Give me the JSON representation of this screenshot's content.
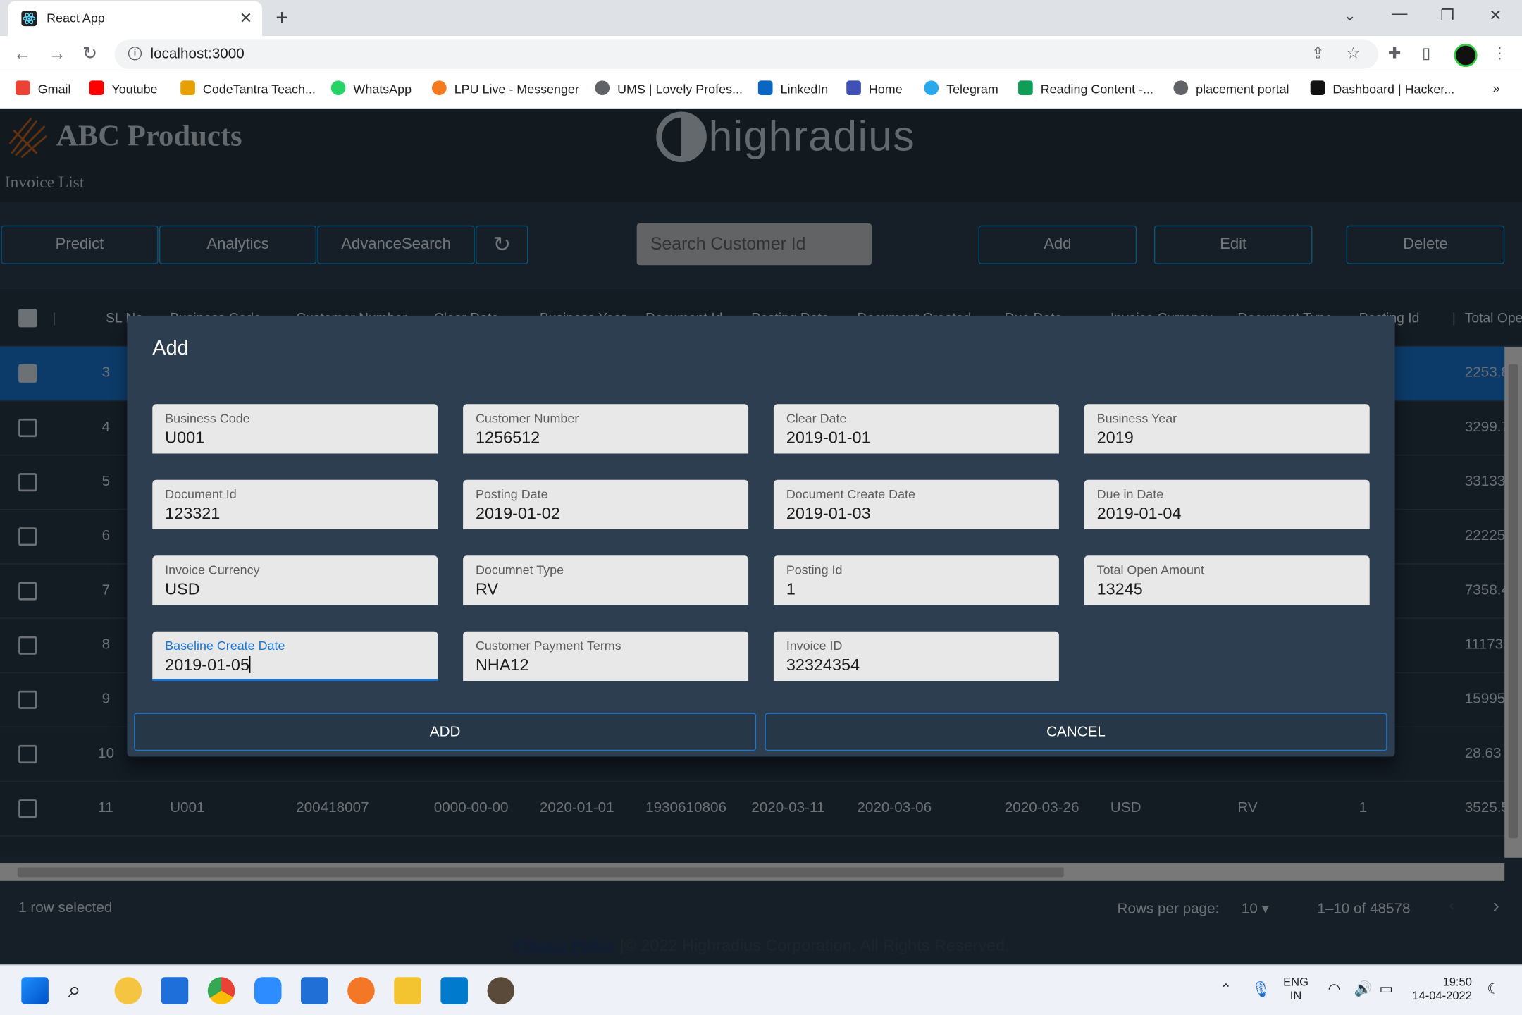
{
  "browser": {
    "tab_title": "React App",
    "url": "localhost:3000",
    "bookmarks": [
      "Gmail",
      "Youtube",
      "CodeTantra Teach...",
      "WhatsApp",
      "LPU Live - Messenger",
      "UMS | Lovely Profes...",
      "LinkedIn",
      "Home",
      "Telegram",
      "Reading Content -...",
      "placement portal",
      "Dashboard | Hacker..."
    ],
    "more_bookmarks": "»"
  },
  "app": {
    "brand": "ABC Products",
    "partner_logo_text": "highradius",
    "subtitle": "Invoice List",
    "toolbar": {
      "predict": "Predict",
      "analytics": "Analytics",
      "advance_search": "AdvanceSearch",
      "refresh_icon": "refresh-icon",
      "search_placeholder": "Search Customer Id",
      "add": "Add",
      "edit": "Edit",
      "delete": "Delete"
    },
    "grid": {
      "columns": [
        "SL No",
        "Business Code",
        "Customer Number",
        "Clear Date",
        "Business Year",
        "Document Id",
        "Posting Date",
        "Document Created",
        "Due Date",
        "Invoice Currency",
        "Document Type",
        "Posting Id",
        "Total Ope"
      ],
      "rows": [
        {
          "sl": "3",
          "selected": true,
          "total": "2253.8"
        },
        {
          "sl": "4",
          "total": "3299.7"
        },
        {
          "sl": "5",
          "total": "33133"
        },
        {
          "sl": "6",
          "total": "22225"
        },
        {
          "sl": "7",
          "total": "7358.4"
        },
        {
          "sl": "8",
          "total": "11173."
        },
        {
          "sl": "9",
          "total": "15995"
        },
        {
          "sl": "10",
          "total": "28.63"
        },
        {
          "sl": "11",
          "business_code": "U001",
          "customer_number": "200418007",
          "clear_date": "0000-00-00",
          "business_year": "2020-01-01",
          "document_id": "1930610806",
          "posting_date": "2020-03-11",
          "document_created": "2020-03-06",
          "due_date": "2020-03-26",
          "currency": "USD",
          "doc_type": "RV",
          "posting_id": "1",
          "total": "3525.5"
        }
      ]
    },
    "pagination": {
      "selected_text": "1 row selected",
      "rows_per_page_label": "Rows per page:",
      "rows_per_page": "10",
      "range": "1–10 of 48578"
    },
    "footer": {
      "privacy": "Privacy Policy",
      "copyright": " |© 2022 Highradius Corporation. All Rights Reserved."
    }
  },
  "dialog": {
    "title": "Add",
    "fields": [
      {
        "label": "Business Code",
        "value": "U001"
      },
      {
        "label": "Customer Number",
        "value": "1256512"
      },
      {
        "label": "Clear Date",
        "value": "2019-01-01"
      },
      {
        "label": "Business Year",
        "value": "2019"
      },
      {
        "label": "Document Id",
        "value": "123321"
      },
      {
        "label": "Posting Date",
        "value": "2019-01-02"
      },
      {
        "label": "Document Create Date",
        "value": "2019-01-03"
      },
      {
        "label": "Due in Date",
        "value": "2019-01-04"
      },
      {
        "label": "Invoice Currency",
        "value": "USD"
      },
      {
        "label": "Documnet Type",
        "value": "RV"
      },
      {
        "label": "Posting Id",
        "value": "1"
      },
      {
        "label": "Total Open Amount",
        "value": "13245"
      },
      {
        "label": "Baseline Create Date",
        "value": "2019-01-05"
      },
      {
        "label": "Customer Payment Terms",
        "value": "NHA12"
      },
      {
        "label": "Invoice ID",
        "value": "32324354"
      }
    ],
    "add_button": "ADD",
    "cancel_button": "CANCEL"
  },
  "taskbar": {
    "language": "ENG",
    "region": "IN",
    "time": "19:50",
    "date": "14-04-2022"
  },
  "colors": {
    "accent": "#1976d2",
    "app_bg": "#2c3e50",
    "button_border": "#14aaf5"
  }
}
